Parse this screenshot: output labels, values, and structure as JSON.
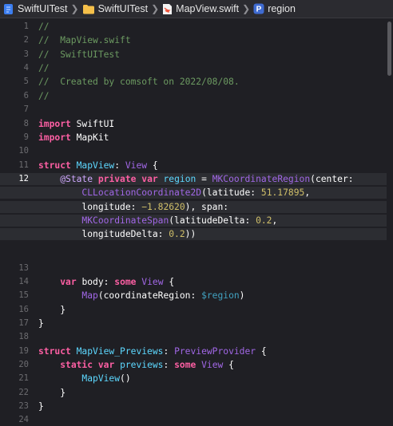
{
  "breadcrumb": [
    {
      "label": "SwiftUITest",
      "icon": "xcode-project-icon"
    },
    {
      "label": "SwiftUITest",
      "icon": "folder-icon"
    },
    {
      "label": "MapView.swift",
      "icon": "swift-file-icon"
    },
    {
      "label": "region",
      "icon": "property-icon",
      "icon_text": "P"
    }
  ],
  "editor": {
    "current_line": "12",
    "lines": [
      {
        "n": "1",
        "t": "//"
      },
      {
        "n": "2",
        "t": "//  MapView.swift"
      },
      {
        "n": "3",
        "t": "//  SwiftUITest"
      },
      {
        "n": "4",
        "t": "//"
      },
      {
        "n": "5",
        "t": "//  Created by comsoft on 2022/08/08."
      },
      {
        "n": "6",
        "t": "//"
      },
      {
        "n": "7",
        "t": ""
      },
      {
        "n": "8",
        "t": "import SwiftUI"
      },
      {
        "n": "9",
        "t": "import MapKit"
      },
      {
        "n": "10",
        "t": ""
      },
      {
        "n": "11",
        "t": "struct MapView: View {"
      },
      {
        "n": "12",
        "t": "    @State private var region = MKCoordinateRegion(center:"
      },
      {
        "n": "",
        "t": "        CLLocationCoordinate2D(latitude: 51.17895,"
      },
      {
        "n": "",
        "t": "        longitude: −1.82620), span:"
      },
      {
        "n": "",
        "t": "        MKCoordinateSpan(latitudeDelta: 0.2,"
      },
      {
        "n": "",
        "t": "        longitudeDelta: 0.2))"
      },
      {
        "n": "13",
        "t": ""
      },
      {
        "n": "14",
        "t": "    var body: some View {"
      },
      {
        "n": "15",
        "t": "        Map(coordinateRegion: $region)"
      },
      {
        "n": "16",
        "t": "    }"
      },
      {
        "n": "17",
        "t": "}"
      },
      {
        "n": "18",
        "t": ""
      },
      {
        "n": "19",
        "t": "struct MapView_Previews: PreviewProvider {"
      },
      {
        "n": "20",
        "t": "    static var previews: some View {"
      },
      {
        "n": "21",
        "t": "        MapView()"
      },
      {
        "n": "22",
        "t": "    }"
      },
      {
        "n": "23",
        "t": "}"
      },
      {
        "n": "24",
        "t": ""
      }
    ]
  }
}
